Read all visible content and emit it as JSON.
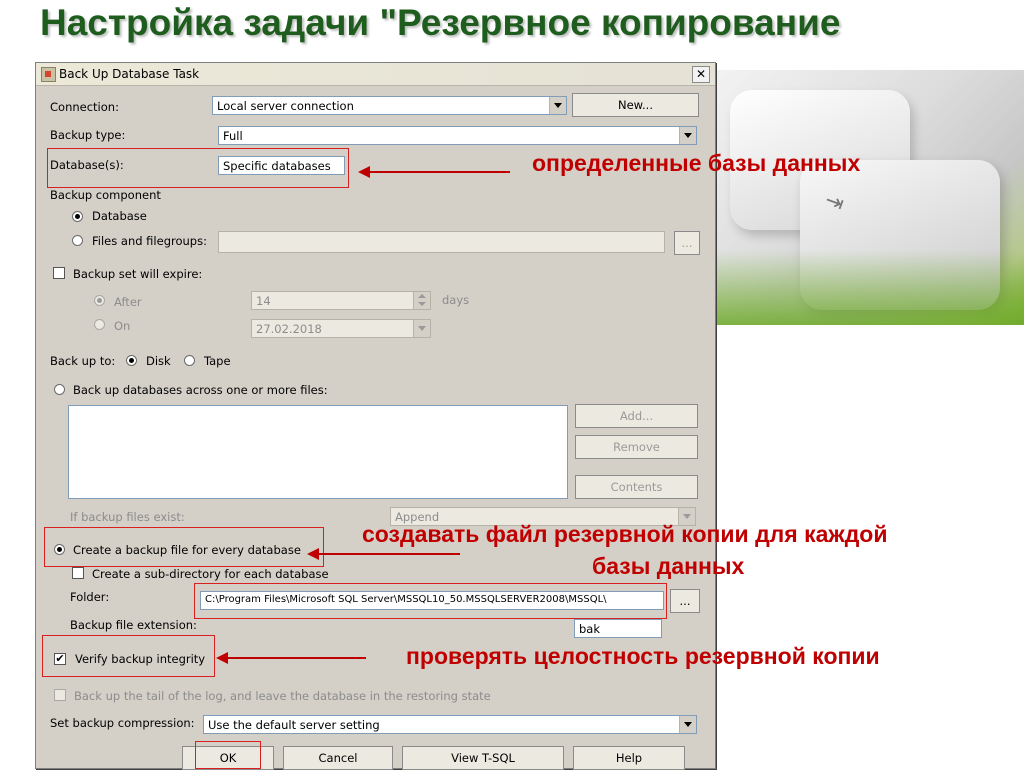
{
  "slide": {
    "title": "Настройка задачи \"Резервное копирование"
  },
  "window": {
    "title": "Back Up Database Task",
    "close_symbol": "✕",
    "icon": "app-icon"
  },
  "form": {
    "connection_label": "Connection:",
    "connection_value": "Local server connection",
    "new_button": "New...",
    "backup_type_label": "Backup type:",
    "backup_type_value": "Full",
    "databases_label": "Database(s):",
    "databases_value": "Specific databases",
    "backup_component_label": "Backup component",
    "component_database": "Database",
    "component_files": "Files and filegroups:",
    "browse_button": "...",
    "expire_label": "Backup set will expire:",
    "after_label": "After",
    "after_value": "14",
    "days_label": "days",
    "on_label": "On",
    "on_value": "27.02.2018",
    "backup_to_label": "Back up to:",
    "disk_label": "Disk",
    "tape_label": "Tape",
    "across_files_label": "Back up databases across one or more files:",
    "add_button": "Add...",
    "remove_button": "Remove",
    "contents_button": "Contents",
    "if_exist_label": "If backup files exist:",
    "if_exist_value": "Append",
    "create_per_db_label": "Create a backup file for every database",
    "subdir_label": "Create a sub-directory for each database",
    "folder_label": "Folder:",
    "folder_value": "C:\\Program Files\\Microsoft SQL Server\\MSSQL10_50.MSSQLSERVER2008\\MSSQL\\",
    "folder_browse": "...",
    "extension_label": "Backup file extension:",
    "extension_value": "bak",
    "verify_label": "Verify backup integrity",
    "verify_checked": "✔",
    "tail_log_label": "Back up the tail of the log, and leave the database in the restoring state",
    "compression_label": "Set backup compression:",
    "compression_value": "Use the default server setting"
  },
  "buttons": {
    "ok": "OK",
    "cancel": "Cancel",
    "view_tsql": "View T-SQL",
    "help": "Help"
  },
  "annotations": {
    "specific_db": "определенные базы данных",
    "per_db_line1": "создавать файл резервной копии для каждой",
    "per_db_line2": "базы данных",
    "verify": "проверять целостность резервной копии",
    "color": "#c00000"
  }
}
